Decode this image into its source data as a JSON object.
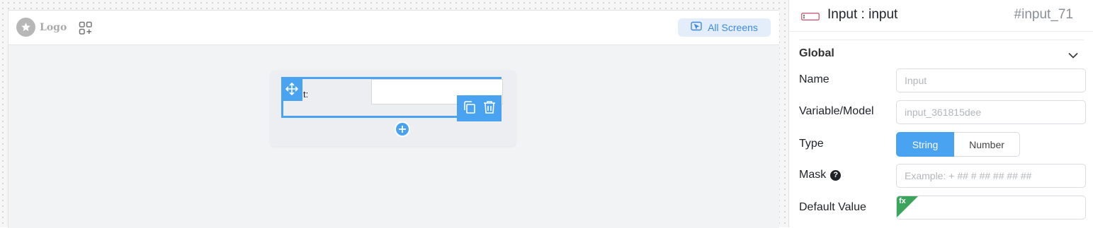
{
  "canvas": {
    "logo_text": "Logo",
    "all_screens_label": "All Screens",
    "input_label_fragment": "t:"
  },
  "panel": {
    "title": "Input : input",
    "component_id": "#input_71",
    "section_title": "Global",
    "name_label": "Name",
    "name_placeholder": "Input",
    "variable_label": "Variable/Model",
    "variable_placeholder": "input_361815dee",
    "type_label": "Type",
    "type_options": [
      "String",
      "Number"
    ],
    "type_selected": "String",
    "mask_label": "Mask",
    "mask_help": "?",
    "mask_placeholder": "Example: + ## # ## ## ## ##",
    "default_label": "Default Value",
    "default_fx": "fx"
  },
  "colors": {
    "accent": "#4aa3f0",
    "fx_badge": "#3ba55d",
    "all_screens_bg": "#e4eefb",
    "all_screens_text": "#3d8ae0"
  },
  "icons": [
    "star-icon",
    "apps-add-icon",
    "screen-cursor-icon",
    "move-icon",
    "copy-icon",
    "trash-icon",
    "plus-icon",
    "input-component-icon",
    "chevron-down-icon",
    "help-icon"
  ]
}
